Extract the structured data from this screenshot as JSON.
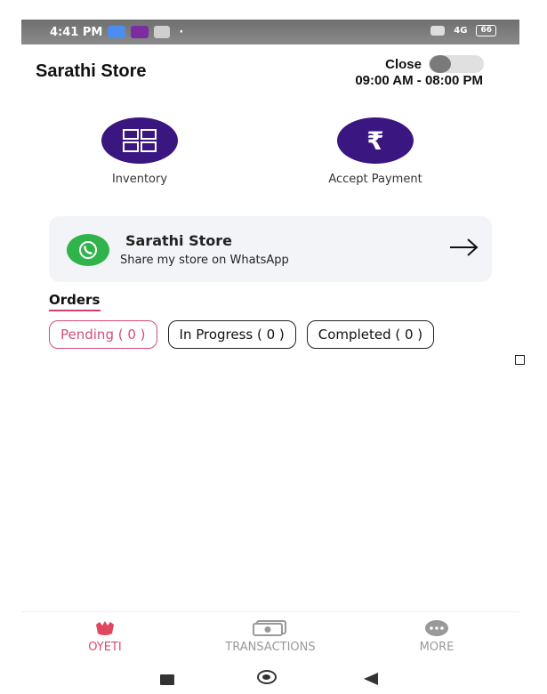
{
  "status_bar": {
    "time": "4:41 PM",
    "battery": "66",
    "network": "4G"
  },
  "header": {
    "store_name": "Sarathi Store",
    "close_label": "Close",
    "hours": "09:00 AM - 08:00 PM"
  },
  "actions": [
    {
      "label": "Inventory",
      "icon": "inventory-grid-icon"
    },
    {
      "label": "Accept Payment",
      "icon": "rupee-icon"
    }
  ],
  "whatsapp_card": {
    "title": "Sarathi Store",
    "subtitle": "Share my store on WhatsApp"
  },
  "orders": {
    "label": "Orders",
    "tabs": [
      {
        "label": "Pending ( 0 )",
        "active": true
      },
      {
        "label": "In Progress ( 0 )",
        "active": false
      },
      {
        "label": "Completed ( 0 )",
        "active": false
      }
    ]
  },
  "bottom_nav": [
    {
      "label": "OYETI",
      "icon": "oyeti-flower-icon",
      "active": true
    },
    {
      "label": "TRANSACTIONS",
      "icon": "cash-icon",
      "active": false
    },
    {
      "label": "MORE",
      "icon": "more-dots-icon",
      "active": false
    }
  ],
  "colors": {
    "brand_purple": "#3a1680",
    "accent_pink": "#d64c7a",
    "whatsapp_green": "#2fb34a"
  }
}
